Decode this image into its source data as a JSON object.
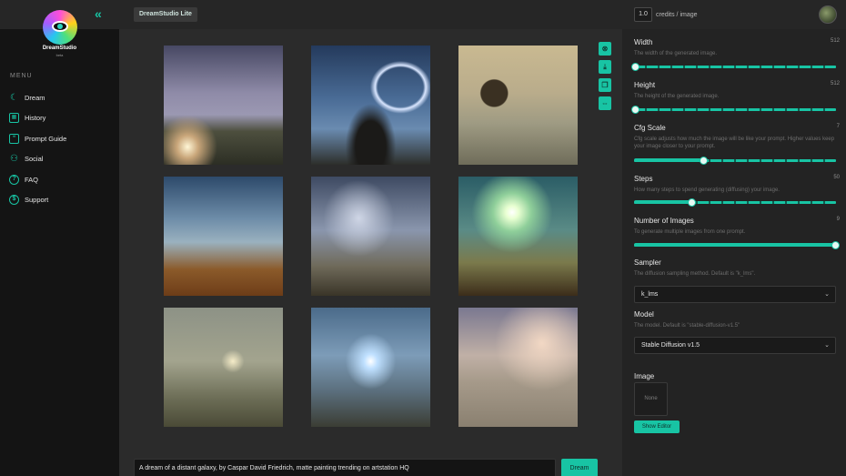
{
  "brand": {
    "name": "DreamStudio",
    "sub": "beta"
  },
  "topbar": {
    "app_tag": "DreamStudio Lite",
    "credits_value": "1.0",
    "credits_label": "credits / image"
  },
  "sidebar": {
    "menu_title": "MENU",
    "items": [
      {
        "label": "Dream",
        "icon": "dream-icon"
      },
      {
        "label": "History",
        "icon": "history-icon"
      },
      {
        "label": "Prompt Guide",
        "icon": "prompt-guide-icon"
      },
      {
        "label": "Social",
        "icon": "social-icon"
      },
      {
        "label": "FAQ",
        "icon": "faq-icon"
      },
      {
        "label": "Support",
        "icon": "support-icon"
      }
    ]
  },
  "gallery": {
    "count": 9
  },
  "tools": [
    "remove-icon",
    "download-icon",
    "copy-icon",
    "expand-icon"
  ],
  "prompt": {
    "text": "A dream of a distant galaxy, by Caspar David Friedrich, matte painting trending on artstation HQ",
    "button": "Dream"
  },
  "settings": {
    "width": {
      "label": "Width",
      "value": "512",
      "desc": "The width of the generated image.",
      "level": 0.0
    },
    "height": {
      "label": "Height",
      "value": "512",
      "desc": "The height of the generated image.",
      "level": 0.0
    },
    "cfg": {
      "label": "Cfg Scale",
      "value": "7",
      "desc": "Cfg scale adjusts how much the image will be like your prompt. Higher values keep your image closer to your prompt.",
      "level": 0.34
    },
    "steps": {
      "label": "Steps",
      "value": "50",
      "desc": "How many steps to spend generating (diffusing) your image.",
      "level": 0.28
    },
    "images": {
      "label": "Number of Images",
      "value": "9",
      "desc": "To generate multiple images from one prompt.",
      "level": 1.0
    },
    "sampler": {
      "label": "Sampler",
      "desc": "The diffusion sampling method. Default is \"k_lms\".",
      "selected": "k_lms"
    },
    "model": {
      "label": "Model",
      "desc": "The model. Default is \"stable-diffusion-v1.5\"",
      "selected": "Stable Diffusion v1.5"
    },
    "image": {
      "label": "Image",
      "placeholder": "None",
      "button": "Show Editor"
    }
  },
  "colors": {
    "accent": "#18c4a4",
    "sidebar_bg": "#141414",
    "main_bg": "#2b2b2b",
    "panel_bg": "#232323"
  }
}
